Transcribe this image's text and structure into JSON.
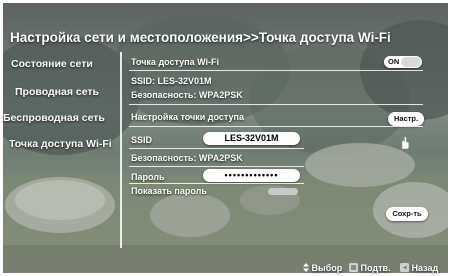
{
  "title": "Настройка сети и местоположения>>Точка доступа Wi-Fi",
  "sidebar": {
    "items": [
      {
        "label": "Состояние сети"
      },
      {
        "label": "Проводная сеть"
      },
      {
        "label": "Беспроводная сеть"
      },
      {
        "label": "Точка доступа Wi-Fi"
      }
    ]
  },
  "main": {
    "hotspot_label": "Точка доступа Wi-Fi",
    "hotspot_toggle": "ON",
    "ssid_info": "SSID: LES-32V01M",
    "security_info": "Безопасность: WPA2PSK",
    "setup_label": "Настройка точки доступа",
    "setup_button": "Настр.",
    "ssid_label": "SSID",
    "ssid_value": "LES-32V01M",
    "security_label": "Безопасность: WPA2PSK",
    "password_label": "Пароль",
    "password_value": "•••••••••••••",
    "show_password_label": "Показать пароль",
    "save_button": "Сохр-ть"
  },
  "footer": {
    "select": "Выбор",
    "confirm": "Подтв.",
    "back": "Назад"
  }
}
